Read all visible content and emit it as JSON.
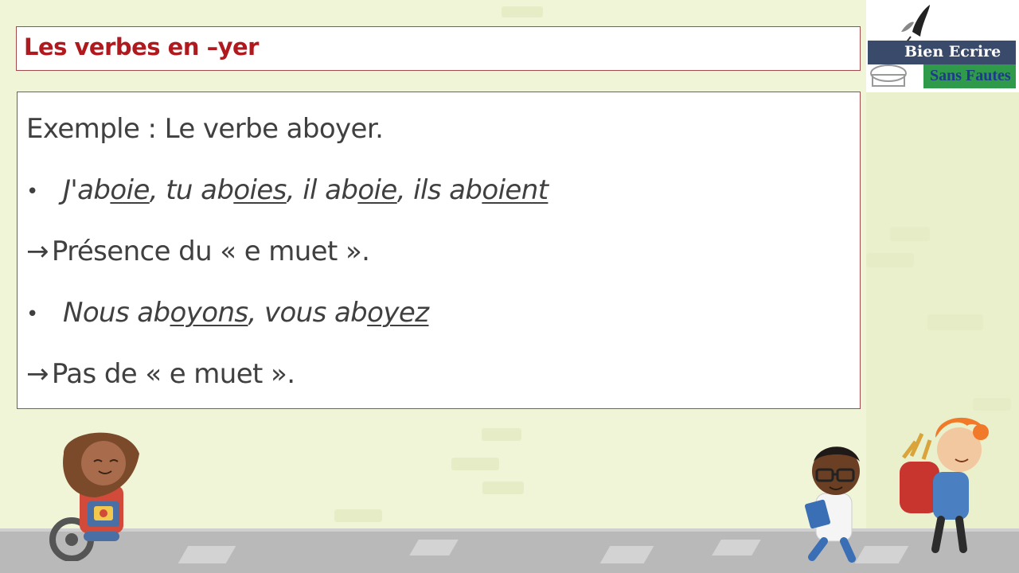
{
  "title": "Les verbes en –yer",
  "logo": {
    "line1": "Bien Ecrire",
    "line2": "Sans Fautes"
  },
  "content": {
    "example": "Exemple : Le verbe aboyer.",
    "bullet": "•",
    "arrow": "→",
    "line2": {
      "p1": "J'ab",
      "p2": "oie",
      "p3": ", tu ab",
      "p4": "oies",
      "p5": ", il ab",
      "p6": "oie",
      "p7": ", ils ab",
      "p8": "oient"
    },
    "line3": "Présence du « e muet ».",
    "line4": {
      "p1": "Nous ab",
      "p2": "oyons",
      "p3": ", vous ab",
      "p4": "oyez"
    },
    "line5": "Pas de « e muet »."
  },
  "colors": {
    "title": "#b0191e",
    "text": "#404040",
    "border": "#a44a4a",
    "background": "#f1f5d8"
  }
}
